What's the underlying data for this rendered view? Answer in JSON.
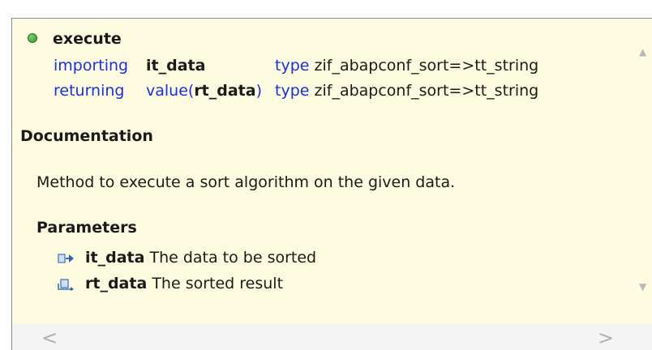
{
  "signature": {
    "method_name": "execute",
    "importing_kw": "importing",
    "param_in": "it_data",
    "type_kw_1": "type",
    "type_1": "zif_abapconf_sort=>tt_string",
    "returning_kw": "returning",
    "value_kw": "value(",
    "param_out": "rt_data",
    "value_close": ")",
    "type_kw_2": "type",
    "type_2": "zif_abapconf_sort=>tt_string"
  },
  "documentation": {
    "title": "Documentation",
    "description": "Method to execute a sort algorithm on the given data.",
    "parameters_title": "Parameters",
    "parameters": [
      {
        "name": "it_data",
        "text": "The data to be sorted",
        "icon": "importing-parameter-icon"
      },
      {
        "name": "rt_data",
        "text": "The sorted result",
        "icon": "returning-parameter-icon"
      }
    ]
  },
  "colors": {
    "background": "#fdfbe0",
    "keyword": "#1a2fe0",
    "bullet": "#3a9a3a"
  },
  "scrollbar": {
    "left_arrow": "<",
    "right_arrow": ">"
  }
}
